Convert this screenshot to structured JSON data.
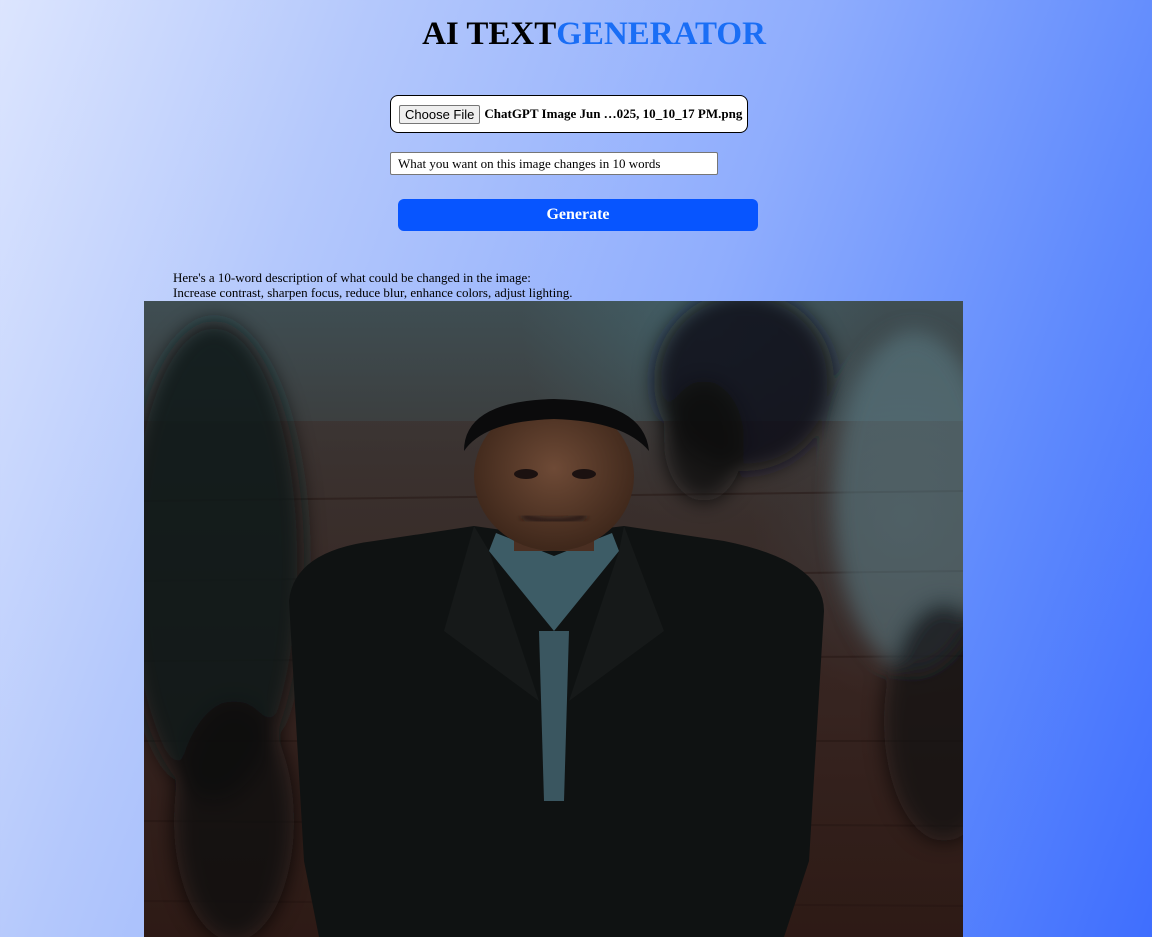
{
  "header": {
    "title_part1": "AI TEXT",
    "title_part2": "GENERATOR"
  },
  "upload": {
    "button_label": "Choose File",
    "file_name": "ChatGPT Image Jun …025, 10_10_17 PM.png"
  },
  "prompt": {
    "value": "What you want on this image changes in 10 words",
    "placeholder": ""
  },
  "generate_button": {
    "label": "Generate"
  },
  "result": {
    "line1": "Here's a 10-word description of what could be changed in the image:",
    "line2": "Increase contrast, sharpen focus, reduce blur, enhance colors, adjust lighting."
  },
  "colors": {
    "accent_blue": "#1a6ef5",
    "button_blue": "#0755ff"
  }
}
